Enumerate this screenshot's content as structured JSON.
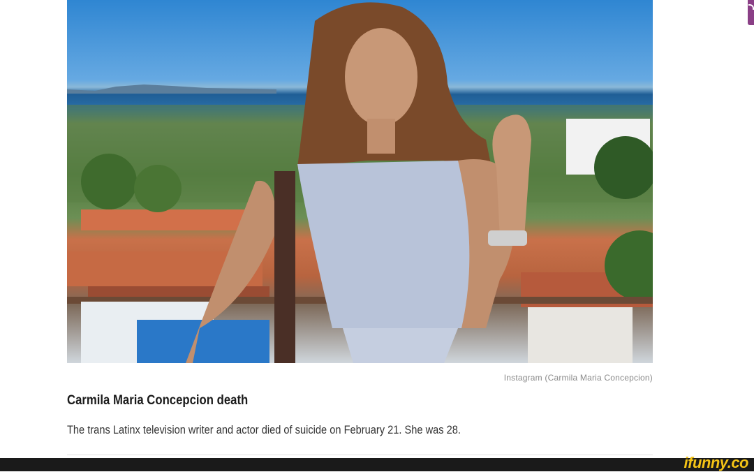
{
  "article": {
    "image_alt": "Woman standing on a balcony overlooking a coastal city",
    "image_credit": "Instagram (Carmila Maria Concepcion)",
    "headline": "Carmila Maria Concepcion death",
    "description": "The trans Latinx television writer and actor died of suicide on February 21. She was 28."
  },
  "watermark": {
    "text": "ifunny.co",
    "color": "#f4c316"
  },
  "corner_icon": "rss-icon"
}
